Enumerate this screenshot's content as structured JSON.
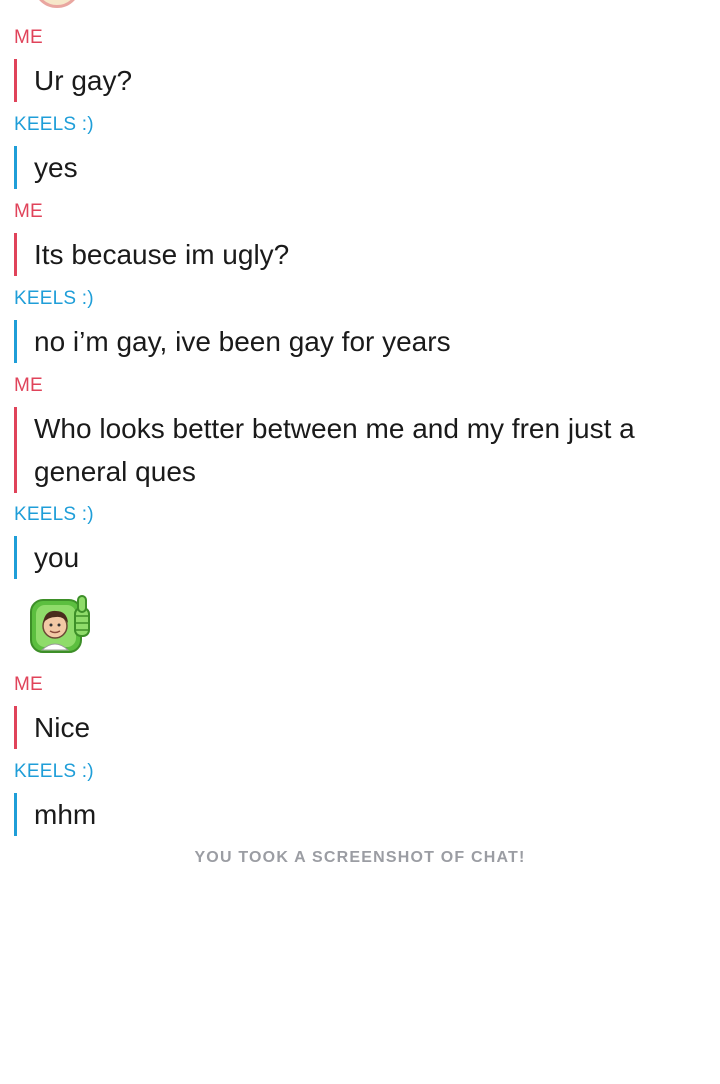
{
  "messages": [
    {
      "sender": "ME",
      "text": "Ur gay?"
    },
    {
      "sender": "KEELS :)",
      "text": "yes"
    },
    {
      "sender": "ME",
      "text": "Its because im ugly?"
    },
    {
      "sender": "KEELS :)",
      "text": "no i’m gay, ive been gay for years"
    },
    {
      "sender": "ME",
      "text": "Who looks better between me and my fren just a general ques"
    },
    {
      "sender": "KEELS :)",
      "text": "you"
    },
    {
      "sender": "ME",
      "text": "Nice"
    },
    {
      "sender": "KEELS :)",
      "text": "mhm"
    }
  ],
  "sticker": {
    "icon": "bitmoji-thumbs-up-icon"
  },
  "screenshot_notice": "YOU TOOK A SCREENSHOT OF CHAT!",
  "colors": {
    "me": "#e0435a",
    "keels": "#1f9ed8",
    "notice": "#9b9da3"
  }
}
